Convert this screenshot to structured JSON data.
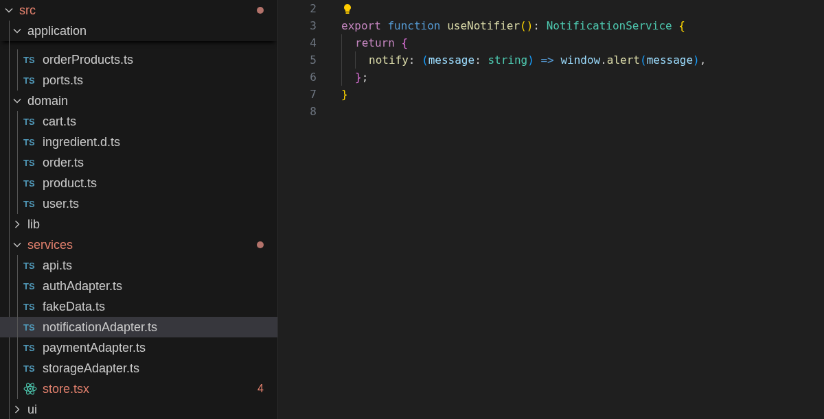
{
  "explorer": {
    "items": [
      {
        "kind": "folder",
        "label": "src",
        "expanded": true,
        "modified": true,
        "dot": true,
        "children": [
          {
            "kind": "folder",
            "label": "application",
            "expanded": true,
            "modified": false,
            "sticky": true,
            "children": [
              {
                "kind": "ts_file",
                "icon_text": "TS",
                "label": "orderProducts.ts",
                "selected": false,
                "modified": false
              },
              {
                "kind": "ts_file",
                "icon_text": "TS",
                "label": "ports.ts",
                "selected": false,
                "modified": false
              }
            ]
          },
          {
            "kind": "folder",
            "label": "domain",
            "expanded": true,
            "modified": false,
            "children": [
              {
                "kind": "ts_file",
                "icon_text": "TS",
                "label": "cart.ts",
                "selected": false,
                "modified": false
              },
              {
                "kind": "ts_file",
                "icon_text": "TS",
                "label": "ingredient.d.ts",
                "selected": false,
                "modified": false
              },
              {
                "kind": "ts_file",
                "icon_text": "TS",
                "label": "order.ts",
                "selected": false,
                "modified": false
              },
              {
                "kind": "ts_file",
                "icon_text": "TS",
                "label": "product.ts",
                "selected": false,
                "modified": false
              },
              {
                "kind": "ts_file",
                "icon_text": "TS",
                "label": "user.ts",
                "selected": false,
                "modified": false
              }
            ]
          },
          {
            "kind": "folder",
            "label": "lib",
            "expanded": false,
            "modified": false
          },
          {
            "kind": "folder",
            "label": "services",
            "expanded": true,
            "modified": true,
            "dot": true,
            "children": [
              {
                "kind": "ts_file",
                "icon_text": "TS",
                "label": "api.ts",
                "selected": false,
                "modified": false
              },
              {
                "kind": "ts_file",
                "icon_text": "TS",
                "label": "authAdapter.ts",
                "selected": false,
                "modified": false
              },
              {
                "kind": "ts_file",
                "icon_text": "TS",
                "label": "fakeData.ts",
                "selected": false,
                "modified": false
              },
              {
                "kind": "ts_file",
                "icon_text": "TS",
                "label": "notificationAdapter.ts",
                "selected": true,
                "modified": false
              },
              {
                "kind": "ts_file",
                "icon_text": "TS",
                "label": "paymentAdapter.ts",
                "selected": false,
                "modified": false
              },
              {
                "kind": "ts_file",
                "icon_text": "TS",
                "label": "storageAdapter.ts",
                "selected": false,
                "modified": false
              },
              {
                "kind": "react_file",
                "label": "store.tsx",
                "selected": false,
                "modified": true,
                "badge": "4"
              }
            ]
          },
          {
            "kind": "folder",
            "label": "ui",
            "expanded": false,
            "modified": false
          }
        ]
      }
    ]
  },
  "editor": {
    "lines": [
      {
        "number": "2",
        "lightbulb": true
      },
      {
        "number": "3",
        "tokens": [
          {
            "kind": "keyword",
            "text": "export"
          },
          {
            "kind": "storage",
            "text": " function "
          },
          {
            "kind": "func",
            "text": "useNotifier"
          },
          {
            "kind": "bracket1",
            "text": "()"
          },
          {
            "kind": "plain",
            "text": ": "
          },
          {
            "kind": "type",
            "text": "NotificationService"
          },
          {
            "kind": "bracket1",
            "text": " {"
          }
        ],
        "children": [
          {
            "number": "4",
            "tokens": [
              {
                "kind": "keyword",
                "text": "return"
              },
              {
                "kind": "bracket2",
                "text": " {"
              }
            ],
            "children": [
              {
                "number": "5",
                "tokens": [
                  {
                    "kind": "func",
                    "text": "notify"
                  },
                  {
                    "kind": "plain",
                    "text": ": "
                  },
                  {
                    "kind": "bracket3",
                    "text": "("
                  },
                  {
                    "kind": "var",
                    "text": "message"
                  },
                  {
                    "kind": "plain",
                    "text": ": "
                  },
                  {
                    "kind": "type",
                    "text": "string"
                  },
                  {
                    "kind": "bracket3",
                    "text": ")"
                  },
                  {
                    "kind": "storage",
                    "text": " => "
                  },
                  {
                    "kind": "var",
                    "text": "window"
                  },
                  {
                    "kind": "plain",
                    "text": "."
                  },
                  {
                    "kind": "func",
                    "text": "alert"
                  },
                  {
                    "kind": "bracket3",
                    "text": "("
                  },
                  {
                    "kind": "var",
                    "text": "message"
                  },
                  {
                    "kind": "bracket3",
                    "text": ")"
                  },
                  {
                    "kind": "plain",
                    "text": ","
                  }
                ]
              }
            ]
          },
          {
            "number": "6",
            "tokens": [
              {
                "kind": "bracket2",
                "text": "}"
              },
              {
                "kind": "plain",
                "text": ";"
              }
            ]
          }
        ]
      },
      {
        "number": "7",
        "tokens": [
          {
            "kind": "bracket1",
            "text": "}"
          }
        ]
      },
      {
        "number": "8"
      }
    ]
  }
}
